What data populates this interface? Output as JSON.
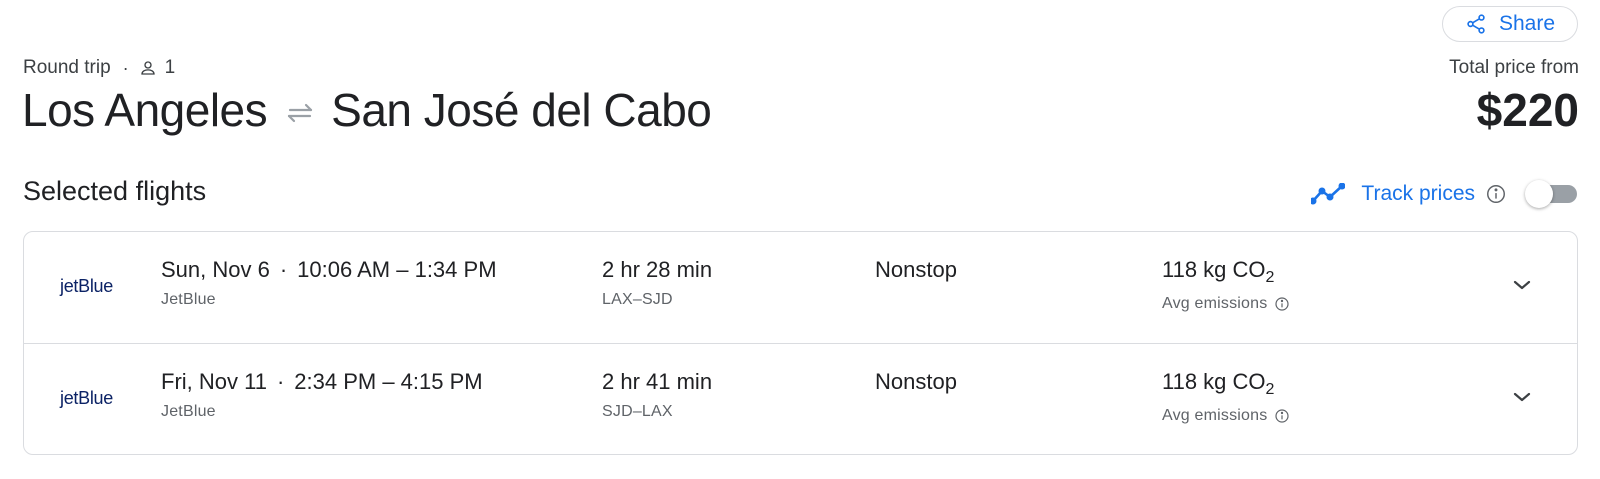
{
  "header": {
    "share_label": "Share",
    "trip_type": "Round trip",
    "separator": "·",
    "passengers": "1",
    "origin": "Los Angeles",
    "destination": "San José del Cabo",
    "total_label": "Total price from",
    "total_price": "$220"
  },
  "section": {
    "title": "Selected flights",
    "track_prices_label": "Track prices",
    "track_prices_enabled": false
  },
  "flights": [
    {
      "airline_logo_text": "jetBlue",
      "date": "Sun, Nov 6",
      "separator": "·",
      "times": "10:06 AM – 1:34 PM",
      "airline": "JetBlue",
      "duration": "2 hr 28 min",
      "route": "LAX–SJD",
      "stops": "Nonstop",
      "emissions_value": "118 kg CO",
      "emissions_sub": "2",
      "emissions_label": "Avg emissions"
    },
    {
      "airline_logo_text": "jetBlue",
      "date": "Fri, Nov 11",
      "separator": "·",
      "times": "2:34 PM – 4:15 PM",
      "airline": "JetBlue",
      "duration": "2 hr 41 min",
      "route": "SJD–LAX",
      "stops": "Nonstop",
      "emissions_value": "118 kg CO",
      "emissions_sub": "2",
      "emissions_label": "Avg emissions"
    }
  ],
  "icons": {
    "share": "share-icon",
    "person": "person-icon",
    "swap": "swap-arrows-icon",
    "track": "trend-line-icon",
    "info": "info-icon",
    "expand": "chevron-down-icon"
  },
  "colors": {
    "accent": "#1a73e8",
    "text_primary": "#202124",
    "text_secondary": "#5f6368",
    "border": "#dadce0",
    "jetblue": "#0b2265"
  }
}
